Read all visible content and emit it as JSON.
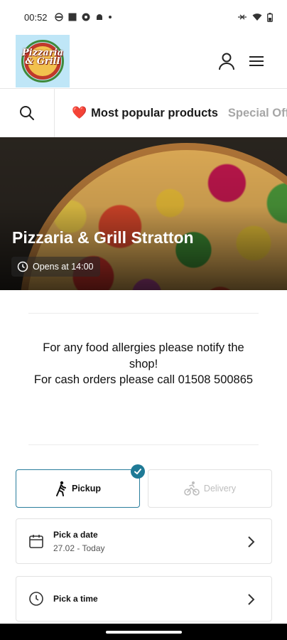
{
  "status_bar": {
    "time": "00:52",
    "icons_left": [
      "app-icon",
      "square-icon",
      "settings-icon",
      "android-icon",
      "dot-icon"
    ],
    "icons_right": [
      "link-icon",
      "wifi-icon",
      "battery-icon"
    ]
  },
  "header": {
    "logo_text_line1": "Pizzaria",
    "logo_text_line2": "& Grill",
    "icons": [
      "user-icon",
      "menu-icon"
    ]
  },
  "categories": {
    "tabs": [
      {
        "label": "Most popular products",
        "emoji": "❤️",
        "active": true
      },
      {
        "label": "Special Offers",
        "active": false
      }
    ]
  },
  "hero": {
    "restaurant_name": "Pizzaria & Grill Stratton",
    "opens_label": "Opens at 14:00"
  },
  "notice": {
    "line1": "For any food allergies please notify the shop!",
    "line2": "For cash orders please call 01508 500865"
  },
  "order_mode": {
    "pickup_label": "Pickup",
    "delivery_label": "Delivery",
    "selected": "pickup",
    "accent_color": "#1f7a96"
  },
  "pickers": {
    "date_label": "Pick a date",
    "date_value": "27.02 - Today",
    "time_label": "Pick a time"
  }
}
